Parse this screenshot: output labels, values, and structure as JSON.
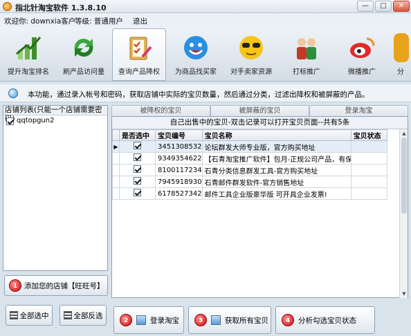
{
  "window": {
    "title": "指北针淘宝软件 1.3.8.10",
    "buttons": {
      "minimize": "—",
      "maximize": "□",
      "close": "✕"
    }
  },
  "userbar": {
    "welcome": "欢迎你: downxia客户",
    "level": "等级: 普通用户",
    "logout": "退出"
  },
  "toolbar": {
    "items": [
      {
        "label": "提升淘宝排名",
        "icon": "bar-chart-icon",
        "color": "#5aa43a"
      },
      {
        "label": "刷产品访问量",
        "icon": "refresh-arrows-icon",
        "color": "#2e9b2e"
      },
      {
        "label": "查询产品降权",
        "icon": "clipboard-check-icon",
        "color": "#d9a441"
      },
      {
        "label": "为商品找买家",
        "icon": "smiley-face-icon",
        "color": "#2b8fe0"
      },
      {
        "label": "对手卖家资源",
        "icon": "sunglasses-face-icon",
        "color": "#f2c21b"
      },
      {
        "label": "打标推广",
        "icon": "people-icon",
        "color": "#c43a2a"
      },
      {
        "label": "微播推广",
        "icon": "weibo-icon",
        "color": "#e02a2a"
      },
      {
        "label": "分",
        "icon": "more-icon",
        "color": "#e8a21b"
      }
    ],
    "active_index": 2
  },
  "info": {
    "text": "本功能，通过录入帐号和密码，获取店铺中实际的宝贝数量，然后通过分类，过滤出降权和被屏蔽的产品。"
  },
  "shop_list": {
    "header": "店铺列表(只能一个店铺需要密码)",
    "items": [
      {
        "name": "qqtopgun2",
        "checked": true
      }
    ]
  },
  "left_buttons": {
    "add_shop": {
      "number": "1",
      "label": "添加您的店铺【旺旺号】"
    },
    "select_all": "全部选中",
    "invert": "全部反选"
  },
  "tabs": [
    "被降权的宝贝",
    "被屏蔽的宝贝",
    "登录淘宝"
  ],
  "grid": {
    "caption": "自己出售中的宝贝-双击记录可以打开宝贝页面--共有5条",
    "columns": [
      "是否选中",
      "宝贝编号",
      "宝贝名称",
      "宝贝状态"
    ],
    "rows": [
      {
        "checked": true,
        "id": "3451308532",
        "name": "论坛群发大师专业版，官方购买地址",
        "status": "",
        "current": true
      },
      {
        "checked": true,
        "id": "9349354622",
        "name": "【石青淘宝推广软件】包月-正规公司产品，有保证",
        "status": ""
      },
      {
        "checked": true,
        "id": "8100117234",
        "name": "石青分类信息群发工具-官方购买地址",
        "status": ""
      },
      {
        "checked": true,
        "id": "7945918930",
        "name": "石青邮件群发软件-官方销售地址",
        "status": ""
      },
      {
        "checked": true,
        "id": "6178527342",
        "name": "邮件工具企业版豪华版 可开具企业发票!",
        "status": ""
      }
    ]
  },
  "actions": [
    {
      "number": "2",
      "label": "登录淘宝"
    },
    {
      "number": "3",
      "label": "获取所有宝贝"
    },
    {
      "number": "4",
      "label": "分析勾选宝贝状态"
    }
  ]
}
